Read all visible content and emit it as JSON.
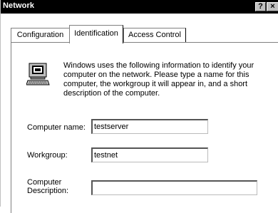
{
  "window": {
    "title": "Network"
  },
  "titlebar": {
    "help_label": "?",
    "close_label": "×"
  },
  "tabs": [
    {
      "label": "Configuration",
      "active": false
    },
    {
      "label": "Identification",
      "active": true
    },
    {
      "label": "Access Control",
      "active": false
    }
  ],
  "identification": {
    "info_lines": [
      "Windows uses the following information to identify your",
      "computer on the network.  Please type a name for this",
      "computer, the workgroup it will appear in, and a short",
      "description of the computer."
    ],
    "computer_name": {
      "label": "Computer name:",
      "value": "testserver"
    },
    "workgroup": {
      "label": "Workgroup:",
      "value": "testnet"
    },
    "description": {
      "label_line1": "Computer",
      "label_line2": "Description:",
      "value": ""
    }
  },
  "icons": {
    "info": "computer-icon"
  }
}
